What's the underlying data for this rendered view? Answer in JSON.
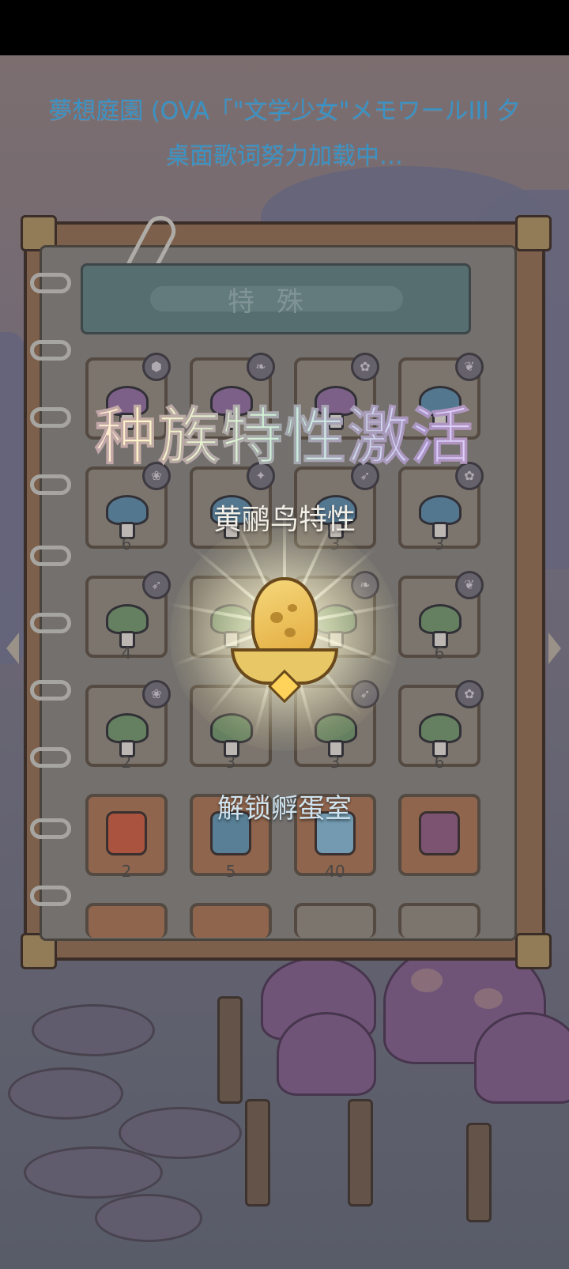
{
  "lyrics": {
    "line1": "夢想庭園 (OVA「\"文学少女\"メモワールIII 夕",
    "line2": "桌面歌词努力加载中…"
  },
  "notebook": {
    "category_title": "特殊",
    "rows": [
      {
        "counts": [
          "",
          "",
          "",
          ""
        ],
        "badges": [
          "shield-icon",
          "bird-icon",
          "flower-icon",
          "sprout-icon"
        ]
      },
      {
        "counts": [
          "6",
          "",
          "3",
          "3"
        ],
        "badges": [
          "leaf-icon",
          "star-icon",
          "feather-icon",
          "flower-icon"
        ]
      },
      {
        "counts": [
          "4",
          "",
          "",
          "6"
        ],
        "badges": [
          "feather-icon",
          "",
          "bird-icon",
          "sprout-icon"
        ]
      },
      {
        "counts": [
          "2",
          "3",
          "3",
          "6"
        ],
        "badges": [
          "leaf-icon",
          "",
          "feather-icon",
          "flower-icon"
        ]
      },
      {
        "counts": [
          "2",
          "5",
          "40",
          ""
        ],
        "badges": [
          "",
          "",
          "",
          ""
        ]
      }
    ]
  },
  "popup": {
    "title": "种族特性激活",
    "subtitle": "黄鹂鸟特性",
    "item_icon": "golden-egg-icon",
    "action": "解锁孵蛋室"
  },
  "colors": {
    "lyrics": "#39a7e0",
    "title_gradient": [
      "#ffd9e6",
      "#fff6c8",
      "#c9f2da",
      "#d6ccff"
    ],
    "egg": "#f5d77a"
  }
}
